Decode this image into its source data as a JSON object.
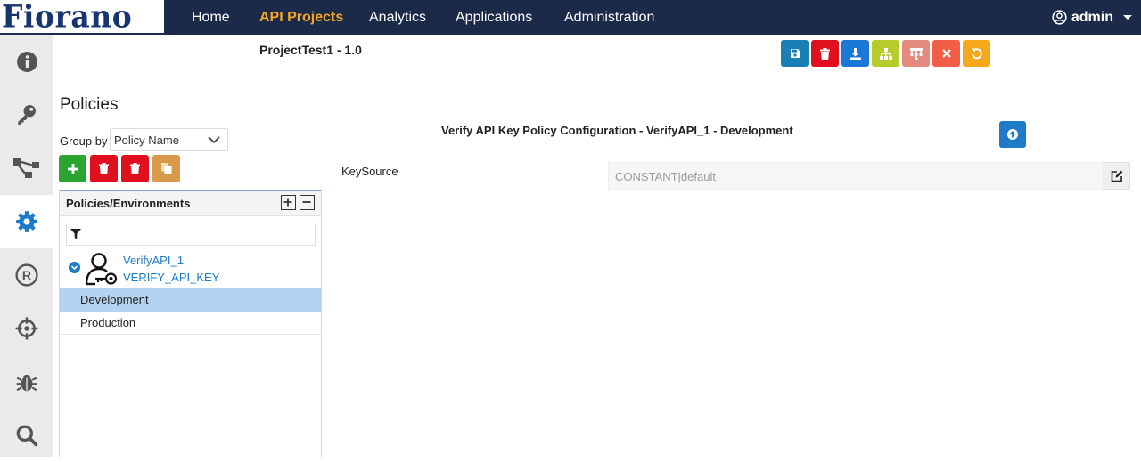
{
  "brand": {
    "logo_text": "Fiorano"
  },
  "nav": {
    "items": [
      {
        "label": "Home"
      },
      {
        "label": "API Projects"
      },
      {
        "label": "Analytics"
      },
      {
        "label": "Applications"
      },
      {
        "label": "Administration"
      }
    ],
    "active": "API Projects",
    "user": {
      "name": "admin"
    }
  },
  "sidebar": {
    "items": [
      {
        "icon": "info-icon"
      },
      {
        "icon": "key-icon"
      },
      {
        "icon": "flow-icon"
      },
      {
        "icon": "gear-icon",
        "active": true
      },
      {
        "icon": "registered-icon"
      },
      {
        "icon": "crosshair-icon"
      },
      {
        "icon": "bug-icon"
      },
      {
        "icon": "search-icon"
      }
    ]
  },
  "project": {
    "title": "ProjectTest1 - 1.0"
  },
  "toolbar": {
    "buttons": [
      {
        "icon": "save-icon",
        "color": "#1a7fb5"
      },
      {
        "icon": "delete-icon",
        "color": "#e0101e"
      },
      {
        "icon": "download-icon",
        "color": "#1a78d6"
      },
      {
        "icon": "hierarchy-icon",
        "color": "#b6cc2a"
      },
      {
        "icon": "tree-structure-icon",
        "color": "#e28a7e"
      },
      {
        "icon": "close-icon",
        "color": "#f25d45"
      },
      {
        "icon": "undo-icon",
        "color": "#f5a81c"
      }
    ]
  },
  "policies": {
    "title": "Policies",
    "group_by_label": "Group by",
    "group_by_value": "Policy Name",
    "tree_header": "Policies/Environments",
    "policy": {
      "name": "VerifyAPI_1",
      "type": "VERIFY_API_KEY"
    },
    "environments": [
      {
        "label": "Development",
        "selected": true
      },
      {
        "label": "Production",
        "selected": false
      }
    ]
  },
  "config": {
    "title": "Verify API Key Policy Configuration - VerifyAPI_1 - Development",
    "fields": [
      {
        "label": "KeySource",
        "value": "CONSTANT|default"
      }
    ]
  },
  "colors": {
    "nav_bg": "#1c2a4a",
    "nav_active": "#f5a623",
    "link_blue": "#1e7bc7",
    "selected_row": "#b3d4f0",
    "add_green": "#2aa52f",
    "delete_red": "#e0101e",
    "copy_orange": "#d89a4a"
  }
}
